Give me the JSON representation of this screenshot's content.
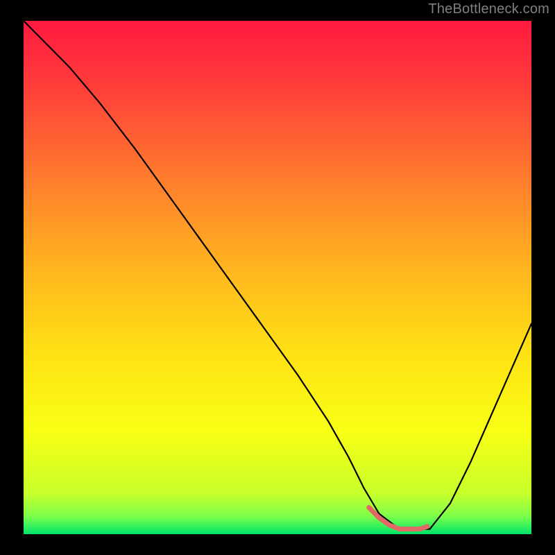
{
  "watermark": {
    "text": "TheBottleneck.com"
  },
  "chart_data": {
    "type": "line",
    "title": "",
    "xlabel": "",
    "ylabel": "",
    "xlim": [
      0,
      100
    ],
    "ylim": [
      0,
      100
    ],
    "grid": false,
    "legend": false,
    "background_gradient": {
      "direction": "top-to-bottom",
      "stops": [
        {
          "pos": 0.0,
          "color": "#ff1a40"
        },
        {
          "pos": 0.12,
          "color": "#ff3b3a"
        },
        {
          "pos": 0.3,
          "color": "#ff7a2e"
        },
        {
          "pos": 0.48,
          "color": "#ffb41f"
        },
        {
          "pos": 0.64,
          "color": "#ffe014"
        },
        {
          "pos": 0.8,
          "color": "#f8ff15"
        },
        {
          "pos": 0.92,
          "color": "#c8ff2a"
        },
        {
          "pos": 0.965,
          "color": "#7dff4a"
        },
        {
          "pos": 1.0,
          "color": "#00e56a"
        }
      ]
    },
    "series": [
      {
        "name": "curve",
        "color": "#000000",
        "x": [
          0,
          4,
          9,
          15,
          22,
          30,
          38,
          46,
          54,
          60,
          64,
          67,
          70,
          74,
          78,
          80,
          84,
          88,
          92,
          96,
          100
        ],
        "y": [
          100,
          96,
          91,
          84,
          75,
          64,
          53,
          42,
          31,
          22,
          15,
          9,
          4,
          1,
          1,
          1,
          6,
          14,
          23,
          32,
          41
        ]
      },
      {
        "name": "highlight",
        "color": "#e16864",
        "x": [
          68,
          70,
          72,
          74,
          76,
          78,
          79.5
        ],
        "y": [
          5.2,
          3.2,
          1.8,
          1.0,
          1.0,
          1.0,
          1.5
        ]
      }
    ],
    "annotations": []
  }
}
